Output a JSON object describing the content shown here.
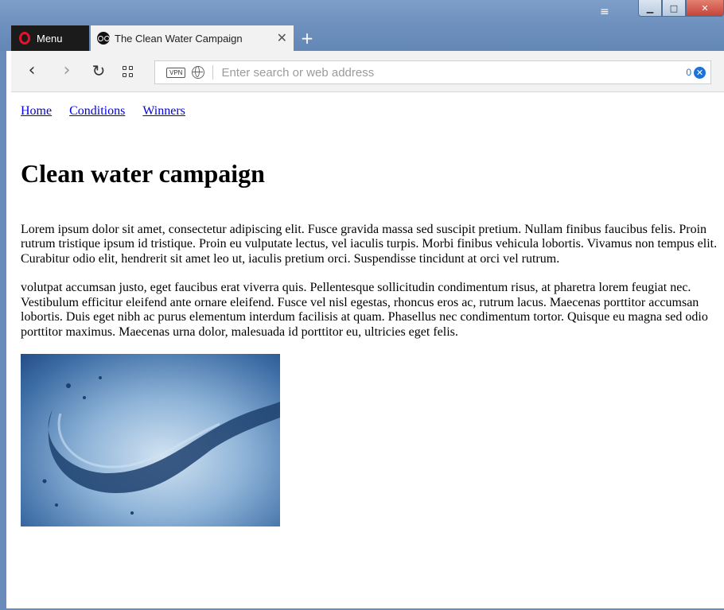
{
  "browser": {
    "menu_label": "Menu",
    "tab_title": "The Clean Water Campaign",
    "tab_close": "✕",
    "new_tab": "+",
    "address_placeholder": "Enter search or web address",
    "vpn_label": "VPN",
    "adblock_count": "0",
    "window_buttons": {
      "minimize": "▁",
      "maximize": "□",
      "close": "✕"
    },
    "accent": "#e3132c"
  },
  "page": {
    "nav": [
      "Home",
      "Conditions",
      "Winners"
    ],
    "title": "Clean water campaign",
    "paragraphs": [
      "Lorem ipsum dolor sit amet, consectetur adipiscing elit. Fusce gravida massa sed suscipit pretium. Nullam finibus faucibus felis. Proin rutrum tristique ipsum id tristique. Proin eu vulputate lectus, vel iaculis turpis. Morbi finibus vehicula lobortis. Vivamus non tempus elit. Curabitur odio elit, hendrerit sit amet leo ut, iaculis pretium orci. Suspendisse tincidunt at orci vel rutrum.",
      "volutpat accumsan justo, eget faucibus erat viverra quis. Pellentesque sollicitudin condimentum risus, at pharetra lorem feugiat nec. Vestibulum efficitur eleifend ante ornare eleifend. Fusce vel nisl egestas, rhoncus eros ac, rutrum lacus. Maecenas porttitor accumsan lobortis. Duis eget nibh ac purus elementum interdum facilisis at quam. Phasellus nec condimentum tortor. Quisque eu magna sed odio porttitor maximus. Maecenas urna dolor, malesuada id porttitor eu, ultricies eget felis."
    ]
  }
}
